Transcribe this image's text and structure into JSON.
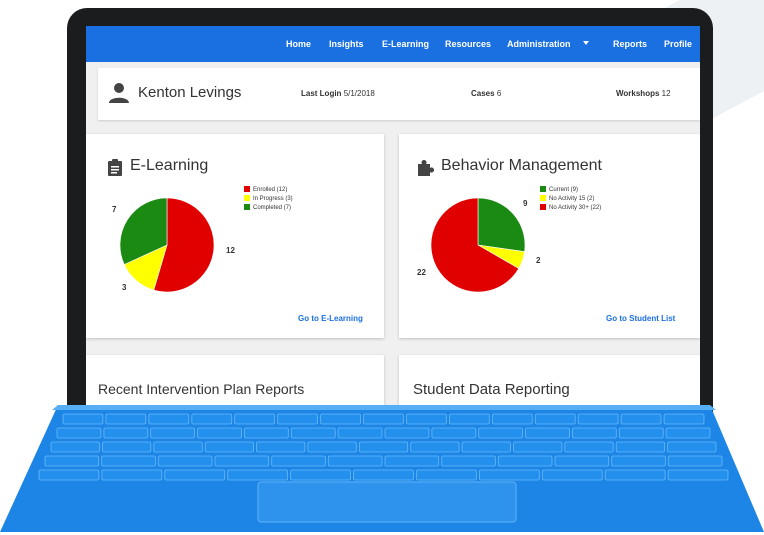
{
  "nav": {
    "items": [
      {
        "label": "Home"
      },
      {
        "label": "Insights"
      },
      {
        "label": "E-Learning"
      },
      {
        "label": "Resources"
      },
      {
        "label": "Administration"
      },
      {
        "label": "Reports"
      },
      {
        "label": "Profile"
      }
    ]
  },
  "profile": {
    "name": "Kenton Levings",
    "last_login_label": "Last Login",
    "last_login_value": "5/1/2018",
    "cases_label": "Cases",
    "cases_value": "6",
    "workshops_label": "Workshops",
    "workshops_value": "12"
  },
  "elearning": {
    "title": "E-Learning",
    "link": "Go to E-Learning",
    "legend": [
      {
        "label": "Enrolled (12)",
        "color": "#e00000"
      },
      {
        "label": "In Progress (3)",
        "color": "#ffff00"
      },
      {
        "label": "Completed (7)",
        "color": "#1a8a12"
      }
    ],
    "labels": {
      "a": "7",
      "b": "12",
      "c": "3"
    }
  },
  "behavior": {
    "title": "Behavior Management",
    "link": "Go to Student List",
    "legend": [
      {
        "label": "Current (9)",
        "color": "#1a8a12"
      },
      {
        "label": "No Activity 15 (2)",
        "color": "#ffff00"
      },
      {
        "label": "No Activity 30+ (22)",
        "color": "#e00000"
      }
    ],
    "labels": {
      "a": "9",
      "b": "2",
      "c": "22"
    }
  },
  "reports": {
    "title": "Recent Intervention Plan Reports"
  },
  "student_data": {
    "title": "Student Data Reporting"
  },
  "chart_data": [
    {
      "type": "pie",
      "title": "E-Learning",
      "categories": [
        "Enrolled",
        "In Progress",
        "Completed"
      ],
      "values": [
        12,
        3,
        7
      ],
      "colors": [
        "#e00000",
        "#ffff00",
        "#1a8a12"
      ]
    },
    {
      "type": "pie",
      "title": "Behavior Management",
      "categories": [
        "Current",
        "No Activity 15",
        "No Activity 30+"
      ],
      "values": [
        9,
        2,
        22
      ],
      "colors": [
        "#1a8a12",
        "#ffff00",
        "#e00000"
      ]
    }
  ],
  "colors": {
    "nav": "#1a70e0",
    "keyboard": "#1d86e8"
  }
}
